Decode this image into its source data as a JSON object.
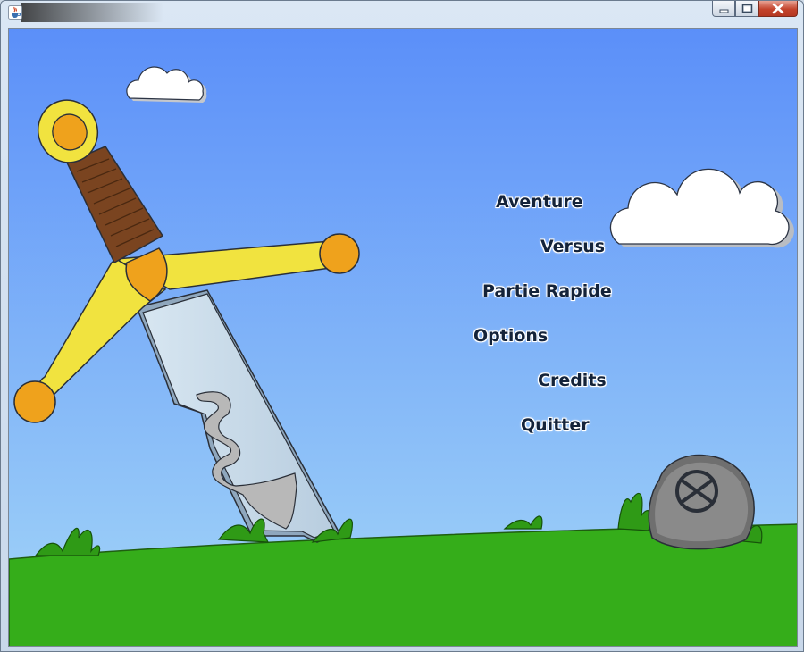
{
  "window": {
    "app_icon": "java-cup-icon",
    "controls": [
      "minimize",
      "maximize",
      "close"
    ]
  },
  "menu": {
    "aventure": "Aventure",
    "versus": "Versus",
    "partie_rapide": "Partie Rapide",
    "options": "Options",
    "credits": "Credits",
    "quitter": "Quitter"
  },
  "colors": {
    "sky_top": "#5b8ff9",
    "sky_bottom": "#a3d6f8",
    "grass": "#35ad1a",
    "sword_guard": "#f1e33f",
    "sword_knobs": "#efa21c",
    "sword_grip": "#7a4420",
    "sword_blade": "#c8dcea",
    "menu_text": "#14233a"
  }
}
